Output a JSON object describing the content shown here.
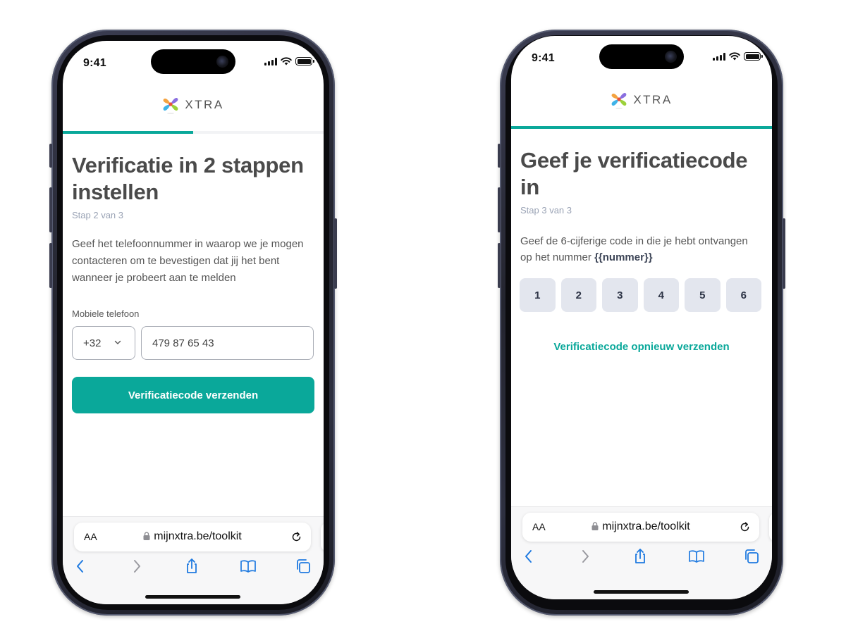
{
  "left_phone": {
    "status_bar": {
      "time": "9:41"
    },
    "logo": {
      "text": "XTRA"
    },
    "progress_percent": 50,
    "title": "Verificatie in 2 stappen instellen",
    "step": "Stap 2 van 3",
    "description": "Geef het telefoonnummer in waarop we je mogen contacteren om te bevestigen dat jij het bent wanneer je probeert aan te melden",
    "phone_field": {
      "label": "Mobiele telefoon",
      "country_code": "+32",
      "value": "479 87 65 43"
    },
    "submit_label": "Verificatiecode verzenden",
    "browser": {
      "aa": "AA",
      "url": "mijnxtra.be/toolkit"
    }
  },
  "right_phone": {
    "status_bar": {
      "time": "9:41"
    },
    "logo": {
      "text": "XTRA"
    },
    "progress_percent": 100,
    "title": "Geef je verificatiecode in",
    "step": "Stap 3 van 3",
    "description_prefix": "Geef de 6-cijferige code in die je hebt ontvangen op het nummer ",
    "description_placeholder": "{{nummer}}",
    "code_digits": [
      "1",
      "2",
      "3",
      "4",
      "5",
      "6"
    ],
    "resend_label": "Verificatiecode opnieuw verzenden",
    "browser": {
      "aa": "AA",
      "url": "mijnxtra.be/toolkit"
    }
  },
  "colors": {
    "accent": "#0aa89a",
    "title": "#4a4a4a",
    "step": "#9aa3b5",
    "code_box": "#e3e6ee",
    "ios_blue": "#1f7ae0"
  }
}
